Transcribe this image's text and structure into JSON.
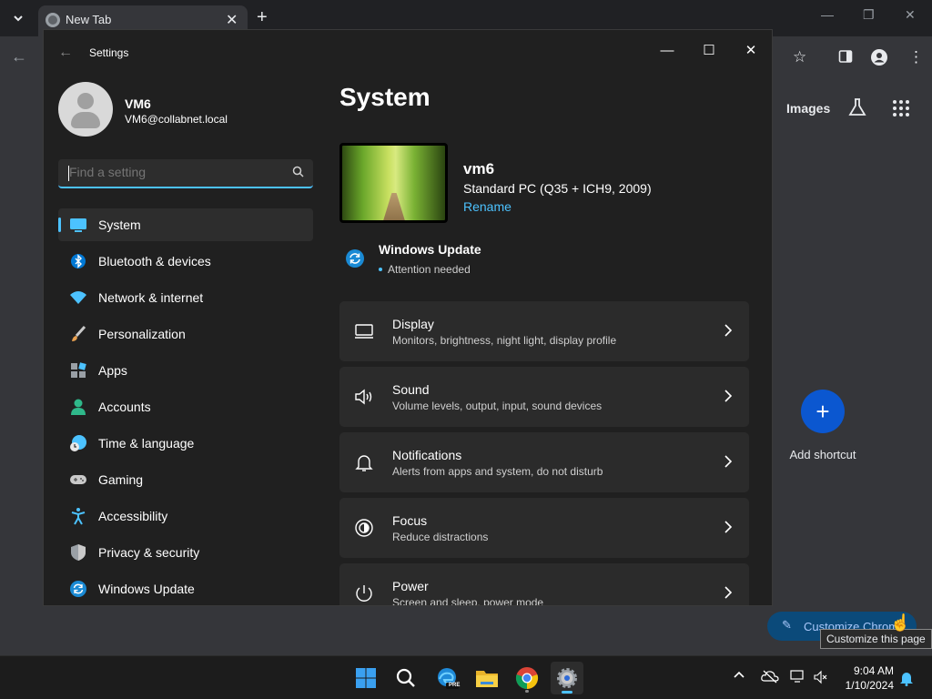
{
  "browser": {
    "tab_title": "New Tab",
    "tab_close": "✕",
    "new_tab": "+",
    "images_link": "Images",
    "add_shortcut_label": "Add shortcut",
    "add_shortcut_plus": "+",
    "customize_button": "Customize Chrome",
    "customize_tooltip": "Customize this page"
  },
  "settings": {
    "window_title": "Settings",
    "user": {
      "name": "VM6",
      "email": "VM6@collabnet.local"
    },
    "search": {
      "placeholder": "Find a setting"
    },
    "nav": [
      {
        "label": "System",
        "icon": "system-icon",
        "selected": true
      },
      {
        "label": "Bluetooth & devices",
        "icon": "bluetooth-icon"
      },
      {
        "label": "Network & internet",
        "icon": "wifi-icon"
      },
      {
        "label": "Personalization",
        "icon": "brush-icon"
      },
      {
        "label": "Apps",
        "icon": "apps-icon"
      },
      {
        "label": "Accounts",
        "icon": "person-icon"
      },
      {
        "label": "Time & language",
        "icon": "globe-clock-icon"
      },
      {
        "label": "Gaming",
        "icon": "gamepad-icon"
      },
      {
        "label": "Accessibility",
        "icon": "accessibility-icon"
      },
      {
        "label": "Privacy & security",
        "icon": "shield-icon"
      },
      {
        "label": "Windows Update",
        "icon": "update-icon"
      }
    ],
    "page_heading": "System",
    "device": {
      "name": "vm6",
      "model": "Standard PC (Q35 + ICH9, 2009)",
      "rename": "Rename"
    },
    "windows_update": {
      "title": "Windows Update",
      "status": "Attention needed"
    },
    "cards": [
      {
        "title": "Display",
        "subtitle": "Monitors, brightness, night light, display profile",
        "icon": "monitor-icon"
      },
      {
        "title": "Sound",
        "subtitle": "Volume levels, output, input, sound devices",
        "icon": "speaker-icon"
      },
      {
        "title": "Notifications",
        "subtitle": "Alerts from apps and system, do not disturb",
        "icon": "bell-icon"
      },
      {
        "title": "Focus",
        "subtitle": "Reduce distractions",
        "icon": "focus-icon"
      },
      {
        "title": "Power",
        "subtitle": "Screen and sleep, power mode",
        "icon": "power-icon"
      }
    ]
  },
  "taskbar": {
    "time": "9:04 AM",
    "date": "1/10/2024",
    "edge_badge": "PRE"
  },
  "colors": {
    "accent": "#4cc2ff",
    "settings_bg": "#202020",
    "card_bg": "#2b2b2b",
    "chrome_bg": "#35363a"
  }
}
